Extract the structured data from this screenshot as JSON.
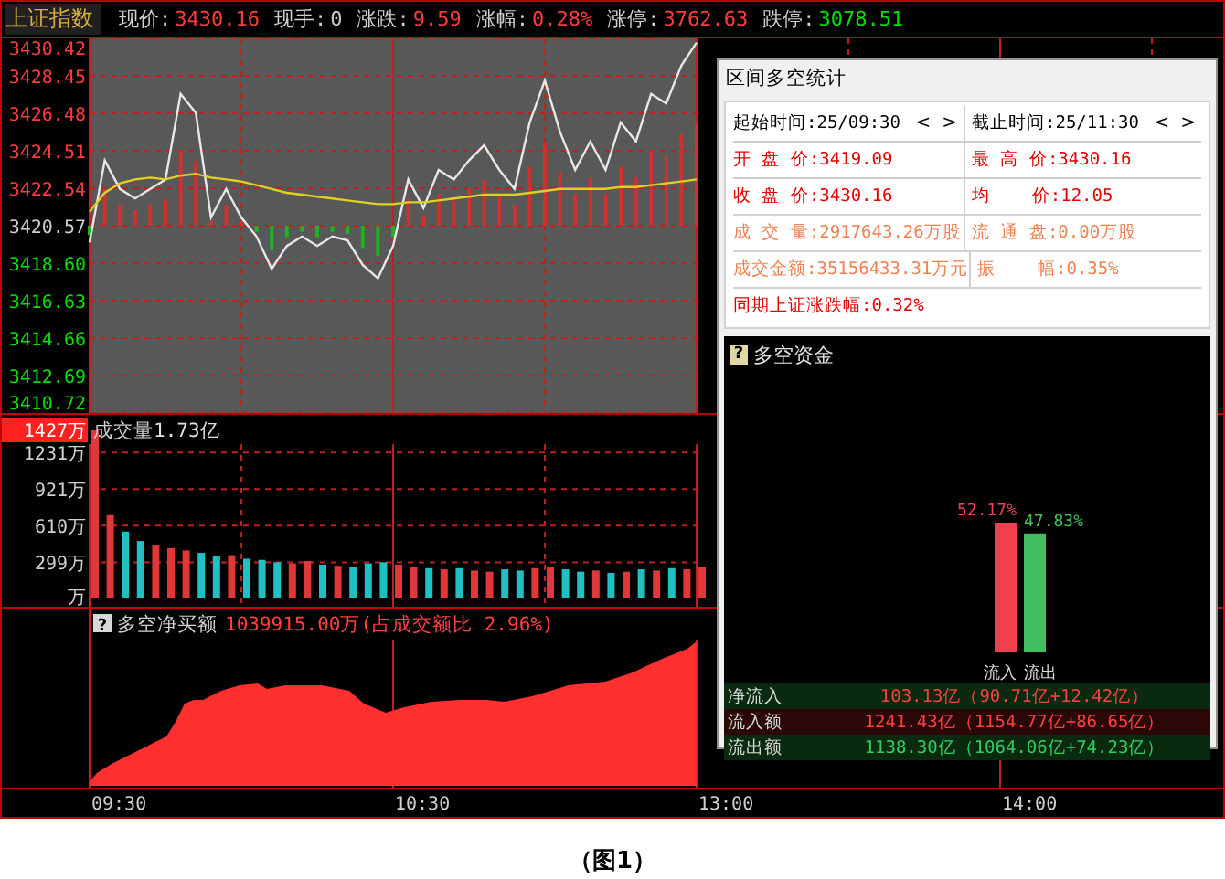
{
  "header": {
    "title": "上证指数",
    "fields": [
      {
        "label": "现价:",
        "value": "3430.16",
        "color": "#ff3c3c"
      },
      {
        "label": "现手:",
        "value": "0",
        "color": "#c8c8c8"
      },
      {
        "label": "涨跌:",
        "value": "9.59",
        "color": "#ff3c3c"
      },
      {
        "label": "涨幅:",
        "value": "0.28%",
        "color": "#ff3c3c"
      },
      {
        "label": "涨停:",
        "value": "3762.63",
        "color": "#ff3c3c"
      },
      {
        "label": "跌停:",
        "value": "3078.51",
        "color": "#00e000"
      }
    ]
  },
  "price_panel": {
    "chart_data": {
      "type": "line",
      "grid": true,
      "ylim": [
        3410.72,
        3430.42
      ],
      "yticks": [
        {
          "value": 3430.42,
          "label": "3430.42"
        },
        {
          "value": 3428.45,
          "label": "3428.45"
        },
        {
          "value": 3426.48,
          "label": "3426.48"
        },
        {
          "value": 3424.51,
          "label": "3424.51"
        },
        {
          "value": 3422.54,
          "label": "3422.54"
        },
        {
          "value": 3420.57,
          "label": "3420.57"
        },
        {
          "value": 3418.6,
          "label": "3418.60"
        },
        {
          "value": 3416.63,
          "label": "3416.63"
        },
        {
          "value": 3414.66,
          "label": "3414.66"
        },
        {
          "value": 3412.69,
          "label": "3412.69"
        },
        {
          "value": 3410.72,
          "label": "3410.72"
        }
      ],
      "series": [
        {
          "color": "#e8e8e8",
          "values": [
            3419.7,
            3424.0,
            3422.5,
            3422.0,
            3422.5,
            3423.0,
            3427.5,
            3426.5,
            3421.0,
            3422.5,
            3421.0,
            3420.0,
            3418.3,
            3419.5,
            3420.0,
            3419.5,
            3420.0,
            3419.8,
            3418.5,
            3417.8,
            3419.5,
            3423.0,
            3421.5,
            3423.5,
            3423.0,
            3424.0,
            3424.8,
            3423.5,
            3422.5,
            3426.0,
            3428.2,
            3425.5,
            3423.5,
            3425.0,
            3423.5,
            3426.0,
            3425.0,
            3427.5,
            3427.0,
            3429.0,
            3430.2,
            null,
            null,
            null,
            null,
            null,
            null,
            null,
            null,
            null,
            null,
            null,
            null,
            null,
            null,
            null,
            null,
            null,
            null,
            null,
            null,
            null,
            null,
            null,
            null,
            null,
            null,
            null,
            null,
            null,
            null,
            null,
            null,
            null,
            null,
            null,
            null,
            null,
            null,
            null
          ]
        },
        {
          "color": "#e0d020",
          "values": [
            3421.3,
            3422.3,
            3422.8,
            3423.0,
            3423.1,
            3423.0,
            3423.2,
            3423.3,
            3423.1,
            3423.0,
            3422.9,
            3422.7,
            3422.5,
            3422.3,
            3422.2,
            3422.1,
            3422.0,
            3421.9,
            3421.8,
            3421.7,
            3421.7,
            3421.8,
            3421.8,
            3421.9,
            3422.0,
            3422.1,
            3422.2,
            3422.2,
            3422.2,
            3422.3,
            3422.4,
            3422.5,
            3422.5,
            3422.5,
            3422.5,
            3422.6,
            3422.6,
            3422.7,
            3422.8,
            3422.9,
            3423.0,
            null,
            null,
            null,
            null,
            null,
            null,
            null,
            null,
            null,
            null,
            null,
            null,
            null,
            null,
            null,
            null,
            null,
            null,
            null,
            null,
            null,
            null,
            null,
            null,
            null,
            null,
            null,
            null,
            null,
            null,
            null,
            null,
            null,
            null,
            null,
            null,
            null,
            null,
            null
          ]
        }
      ]
    }
  },
  "volume_panel": {
    "title": "成交量",
    "total": "1.73亿",
    "chart_data": {
      "type": "bar",
      "grid": true,
      "ylim": [
        0,
        1427
      ],
      "yticks": [
        {
          "value": 1427,
          "label": "1427万"
        },
        {
          "value": 1231,
          "label": "1231万"
        },
        {
          "value": 921,
          "label": "921万"
        },
        {
          "value": 610,
          "label": "610万"
        },
        {
          "value": 299,
          "label": "299万"
        },
        {
          "value": 0,
          "label": "万"
        }
      ],
      "values": [
        1420,
        700,
        560,
        480,
        450,
        420,
        400,
        380,
        350,
        360,
        330,
        320,
        300,
        290,
        310,
        280,
        270,
        260,
        290,
        300,
        280,
        260,
        250,
        240,
        250,
        230,
        220,
        240,
        230,
        250,
        260,
        240,
        220,
        230,
        210,
        220,
        240,
        230,
        250,
        240,
        260,
        null,
        null,
        null,
        null,
        null,
        null,
        null,
        null,
        null,
        null,
        null,
        null,
        null,
        null,
        null,
        null,
        null,
        null,
        null,
        null,
        null,
        null,
        null,
        null,
        null,
        null,
        null,
        null,
        null,
        null,
        null,
        null,
        null,
        null,
        null,
        null,
        null,
        null,
        null
      ]
    }
  },
  "net_buy_panel": {
    "help_glyph": "?",
    "title": "多空净买额",
    "value": "1039915.00万(占成交额比 2.96%)"
  },
  "time_axis": [
    "09:30",
    "10:30",
    "13:00",
    "14:00"
  ],
  "popup": {
    "title": "区间多空统计",
    "rows": [
      {
        "cells": [
          {
            "text": "起始时间:25/09:30",
            "color": "#000000",
            "nav": [
              "<",
              ">"
            ]
          },
          {
            "text": "截止时间:25/11:30",
            "color": "#000000",
            "nav": [
              "<",
              ">"
            ]
          }
        ]
      },
      {
        "cells": [
          {
            "text": "开 盘 价:3419.09",
            "color": "#e00000"
          },
          {
            "text": "最 高 价:3430.16",
            "color": "#e00000"
          }
        ]
      },
      {
        "cells": [
          {
            "text": "收 盘 价:3430.16",
            "color": "#e00000"
          },
          {
            "text": "均    价:12.05",
            "color": "#e00000"
          }
        ]
      },
      {
        "cells": [
          {
            "text": "成 交 量:2917643.26万股",
            "color": "#f08050"
          },
          {
            "text": "流 通 盘:0.00万股",
            "color": "#f08050"
          }
        ]
      },
      {
        "cells": [
          {
            "text": "成交金额:35156433.31万元",
            "color": "#f08050"
          },
          {
            "text": "振    幅:0.35%",
            "color": "#f08050"
          }
        ]
      },
      {
        "cells": [
          {
            "text": "同期上证涨跌幅:0.32%",
            "color": "#e00000"
          }
        ]
      }
    ],
    "fund": {
      "help_glyph": "?",
      "title": "多空资金",
      "chart_data": {
        "type": "bar",
        "categories": [
          "流入",
          "流出"
        ],
        "values": [
          52.17,
          47.83
        ],
        "value_labels": [
          "52.17%",
          "47.83%"
        ]
      },
      "lines": [
        {
          "kind": "net",
          "label": "净流入",
          "value": "103.13亿（90.71亿+12.42亿）"
        },
        {
          "kind": "inflow",
          "label": "流入额",
          "value": "1241.43亿（1154.77亿+86.65亿）"
        },
        {
          "kind": "outflow",
          "label": "流出额",
          "value": "1138.30亿（1064.06亿+74.23亿）"
        }
      ]
    }
  },
  "caption": "（图1）"
}
